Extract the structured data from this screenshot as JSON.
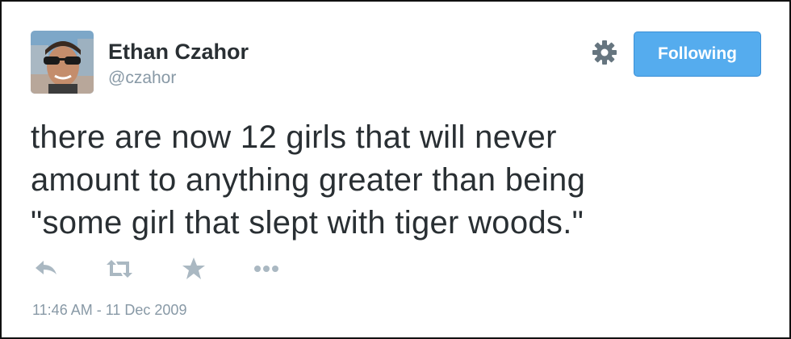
{
  "user": {
    "display_name": "Ethan Czahor",
    "screen_name": "@czahor"
  },
  "follow_button": {
    "label": "Following"
  },
  "tweet": {
    "lines": [
      "there are now 12 girls that will never",
      "amount to anything greater than being",
      "\"some girl that slept with tiger woods.\""
    ],
    "timestamp": "11:46 AM - 11 Dec 2009"
  },
  "actions": {
    "reply_icon": "reply-icon",
    "retweet_icon": "retweet-icon",
    "favorite_icon": "star-icon",
    "more_icon": "ellipsis-icon"
  },
  "colors": {
    "follow_button_bg": "#55acee",
    "name_text": "#292f33",
    "muted_text": "#8899a6",
    "action_icon": "#aab8c2"
  }
}
